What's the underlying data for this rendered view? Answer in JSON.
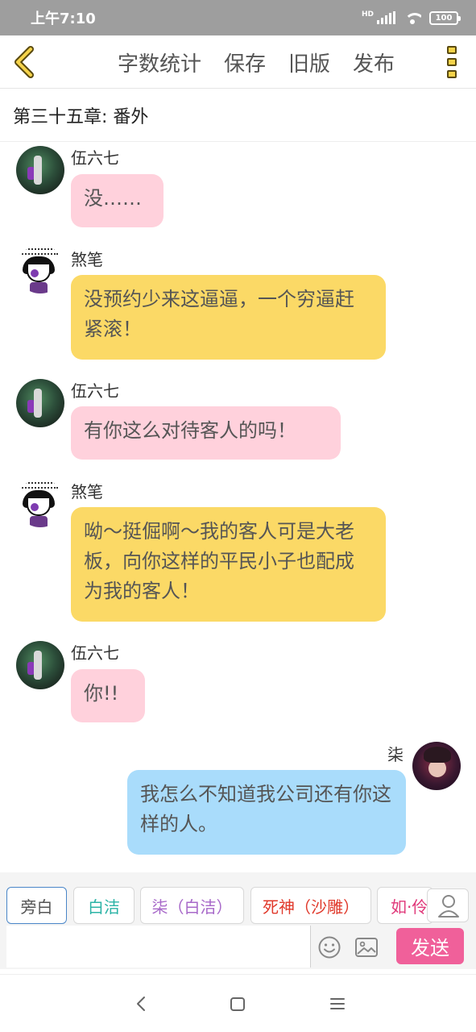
{
  "status_bar": {
    "time": "上午7:10",
    "battery": "100"
  },
  "toolbar": {
    "actions": [
      "字数统计",
      "保存",
      "旧版",
      "发布"
    ]
  },
  "chapter": {
    "title": "第三十五章: 番外"
  },
  "messages": [
    {
      "sender": "伍六七",
      "text": "没……",
      "side": "left",
      "color": "pink"
    },
    {
      "sender": "煞笔",
      "text": "没预约少来这逼逼，一个穷逼赶紧滚！",
      "side": "left",
      "color": "yellow"
    },
    {
      "sender": "伍六七",
      "text": "有你这么对待客人的吗！",
      "side": "left",
      "color": "pink"
    },
    {
      "sender": "煞笔",
      "text": "呦～挺倔啊～我的客人可是大老板，向你这样的平民小子也配成为我的客人！",
      "side": "left",
      "color": "yellow"
    },
    {
      "sender": "伍六七",
      "text": "你!!",
      "side": "left",
      "color": "pink"
    },
    {
      "sender": "柒",
      "text": "我怎么不知道我公司还有你这样的人。",
      "side": "right",
      "color": "blue"
    }
  ],
  "roles": [
    {
      "label": "旁白",
      "color": "#555555",
      "active": true
    },
    {
      "label": "白洁",
      "color": "#2bb3a6",
      "active": false
    },
    {
      "label": "柒（白洁）",
      "color": "#a768c9",
      "active": false
    },
    {
      "label": "死神（沙雕）",
      "color": "#e0392b",
      "active": false
    },
    {
      "label": "如·伶",
      "color": "#e0397a",
      "active": false
    }
  ],
  "composer": {
    "value": "",
    "send_label": "发送"
  },
  "colors": {
    "pink_bubble": "#ffd1dc",
    "yellow_bubble": "#fbd966",
    "blue_bubble": "#a9dcfb",
    "send": "#f0609a",
    "more_icon": "#f5d34a"
  },
  "icons": [
    "back-chevron-icon",
    "more-vertical-icon",
    "emoji-icon",
    "image-icon",
    "person-icon",
    "nav-back-icon",
    "nav-home-icon",
    "nav-menu-icon"
  ]
}
